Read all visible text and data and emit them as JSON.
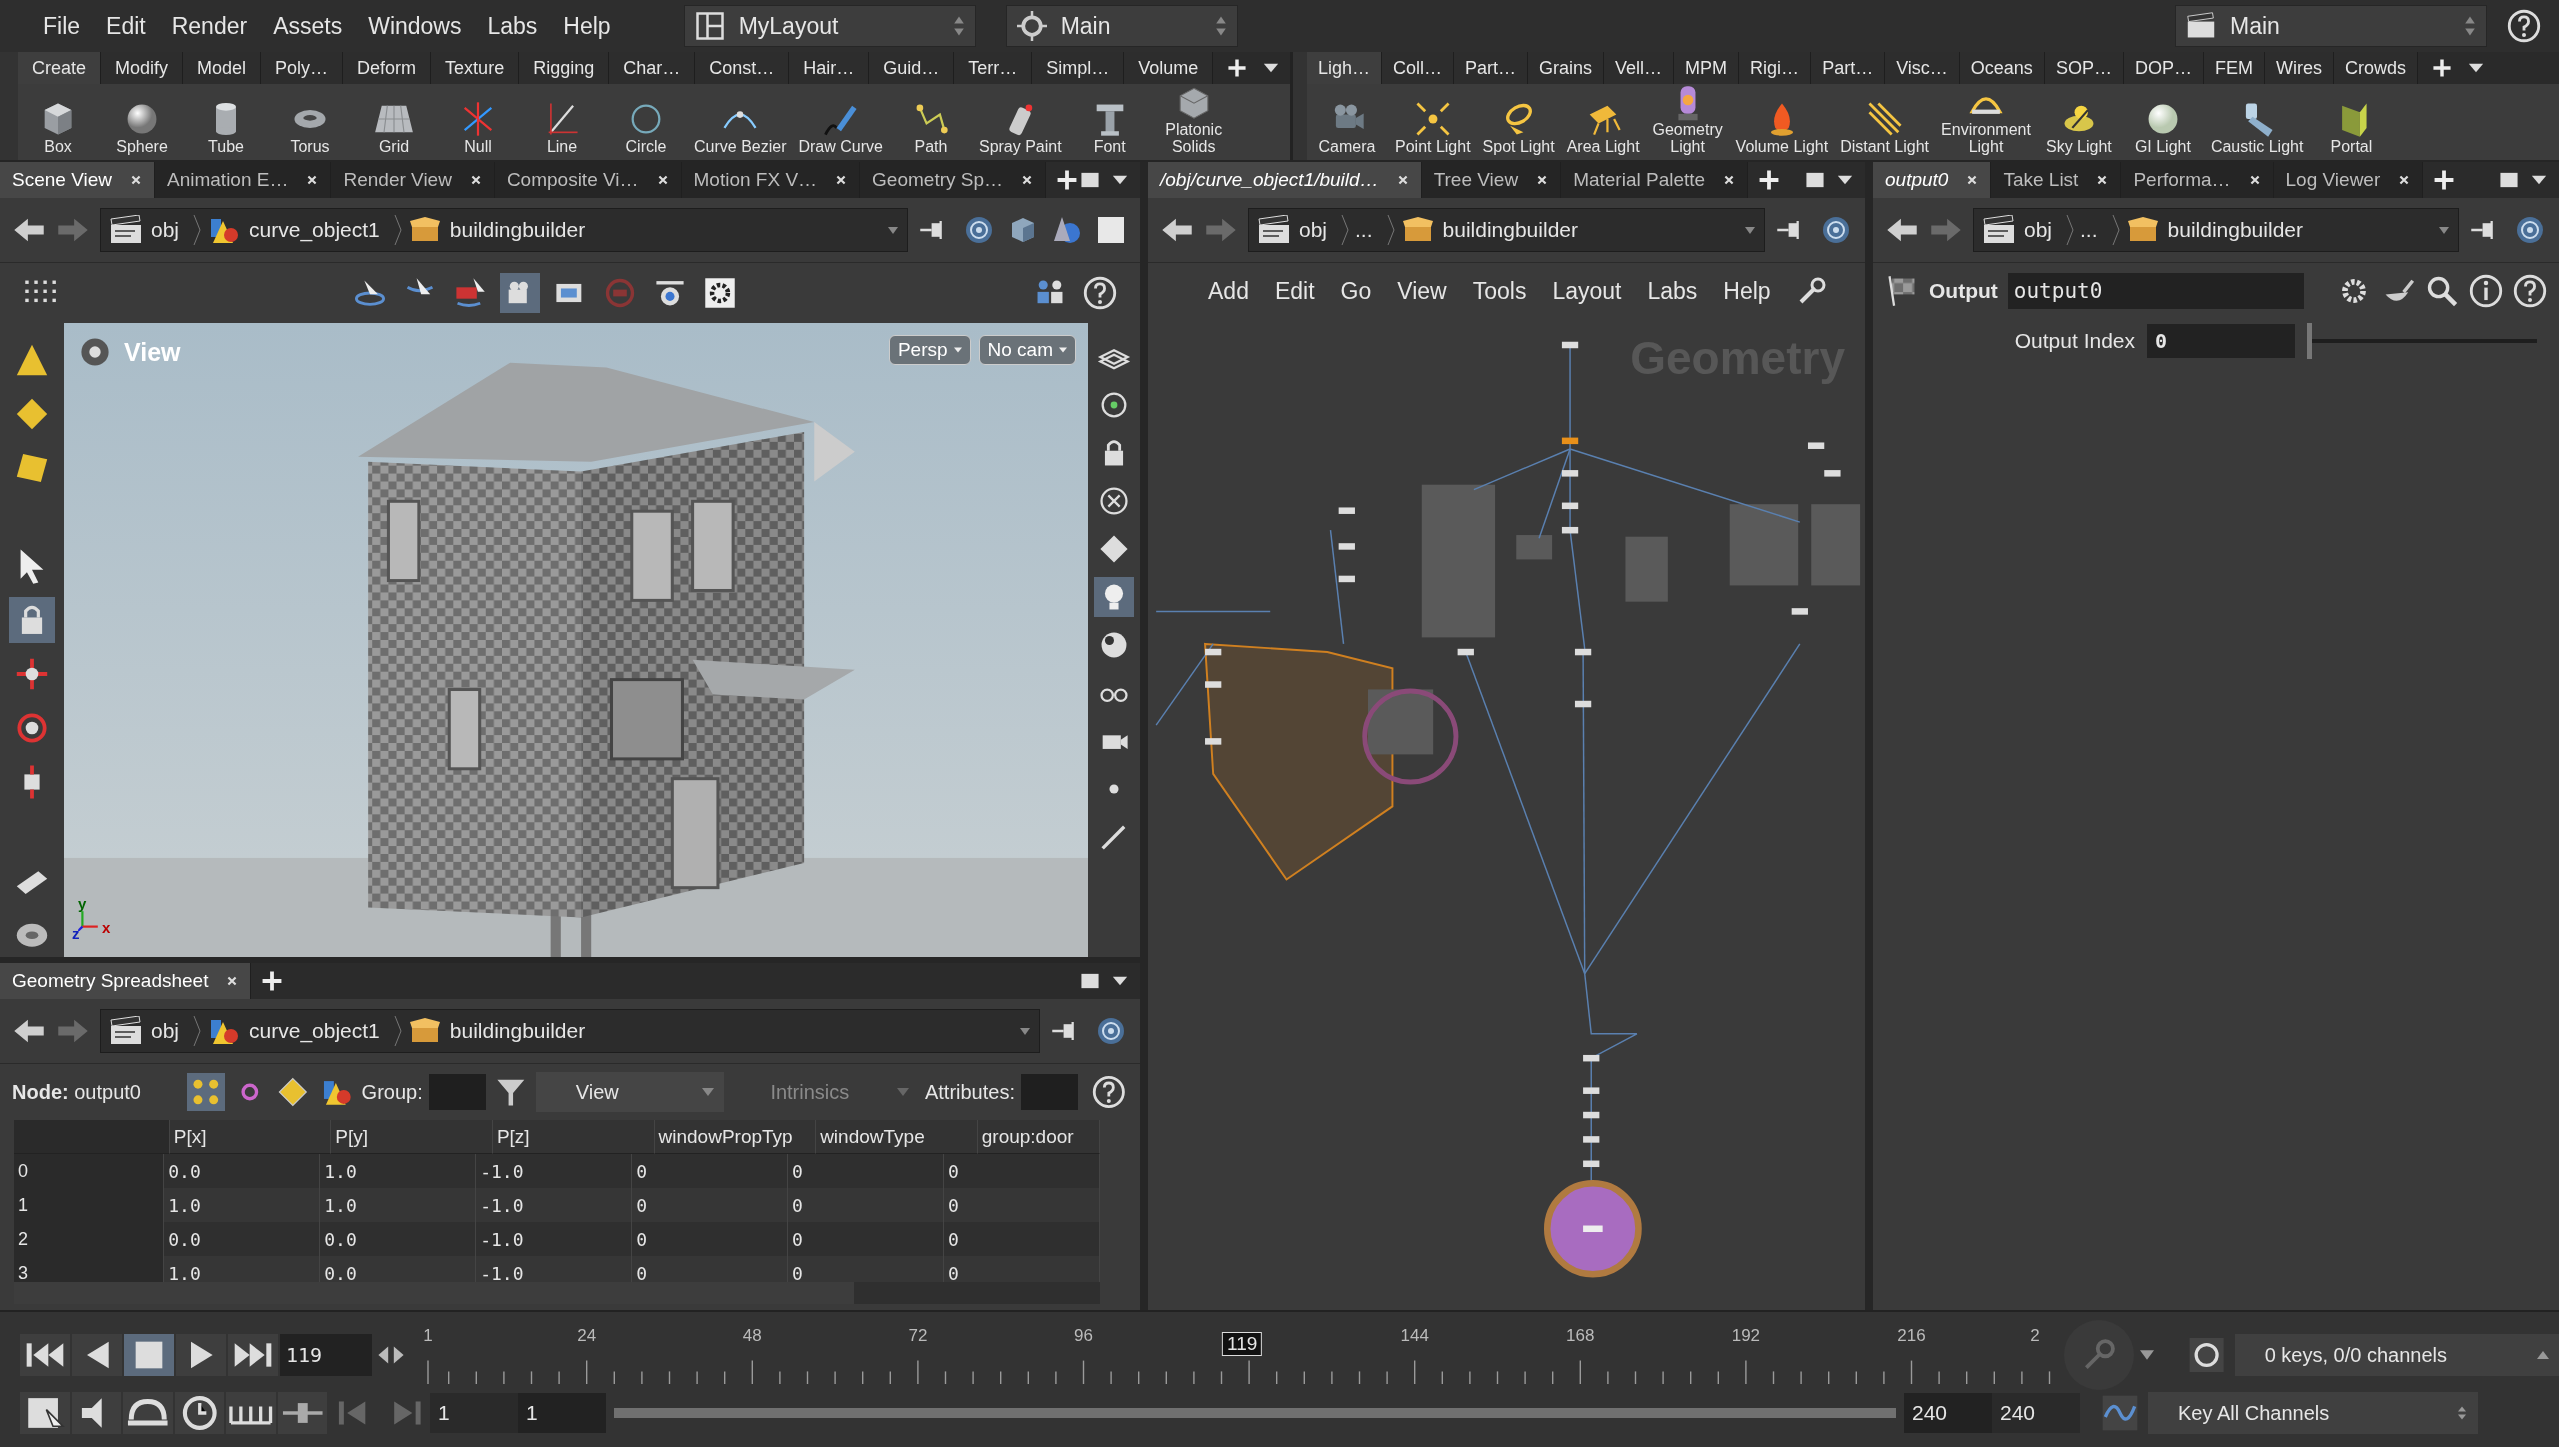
{
  "menu": [
    "File",
    "Edit",
    "Render",
    "Assets",
    "Windows",
    "Labs",
    "Help"
  ],
  "desktop": {
    "layout": "MyLayout",
    "context": "Main"
  },
  "take": "Main",
  "shelf_left": {
    "tabs": [
      {
        "label": "Create",
        "selected": true
      },
      {
        "label": "Modify",
        "selected": false
      },
      {
        "label": "Model",
        "selected": false
      },
      {
        "label": "Poly…",
        "selected": false
      },
      {
        "label": "Deform",
        "selected": false
      },
      {
        "label": "Texture",
        "selected": false
      },
      {
        "label": "Rigging",
        "selected": false
      },
      {
        "label": "Char…",
        "selected": false
      },
      {
        "label": "Const…",
        "selected": false
      },
      {
        "label": "Hair…",
        "selected": false
      },
      {
        "label": "Guid…",
        "selected": false
      },
      {
        "label": "Terr…",
        "selected": false
      },
      {
        "label": "Simpl…",
        "selected": false
      },
      {
        "label": "Volume",
        "selected": false
      }
    ],
    "tools": [
      "Box",
      "Sphere",
      "Tube",
      "Torus",
      "Grid",
      "Null",
      "Line",
      "Circle",
      "Curve Bezier",
      "Draw Curve",
      "Path",
      "Spray Paint",
      "Font",
      "Platonic\nSolids"
    ]
  },
  "shelf_right": {
    "tabs": [
      {
        "label": "Ligh…",
        "selected": true
      },
      {
        "label": "Coll…",
        "selected": false
      },
      {
        "label": "Part…",
        "selected": false
      },
      {
        "label": "Grains",
        "selected": false
      },
      {
        "label": "Vell…",
        "selected": false
      },
      {
        "label": "MPM",
        "selected": false
      },
      {
        "label": "Rigi…",
        "selected": false
      },
      {
        "label": "Part…",
        "selected": false
      },
      {
        "label": "Visc…",
        "selected": false
      },
      {
        "label": "Oceans",
        "selected": false
      },
      {
        "label": "SOP…",
        "selected": false
      },
      {
        "label": "DOP…",
        "selected": false
      },
      {
        "label": "FEM",
        "selected": false
      },
      {
        "label": "Wires",
        "selected": false
      },
      {
        "label": "Crowds",
        "selected": false
      }
    ],
    "tools": [
      "Camera",
      "Point Light",
      "Spot Light",
      "Area Light",
      "Geometry\nLight",
      "Volume Light",
      "Distant Light",
      "Environment\nLight",
      "Sky Light",
      "GI Light",
      "Caustic Light",
      "Portal"
    ]
  },
  "scene_pane": {
    "tabs": [
      {
        "label": "Scene View",
        "selected": true
      },
      {
        "label": "Animation E…",
        "selected": false
      },
      {
        "label": "Render View",
        "selected": false
      },
      {
        "label": "Composite Vi…",
        "selected": false
      },
      {
        "label": "Motion FX V…",
        "selected": false
      },
      {
        "label": "Geometry Sp…",
        "selected": false
      }
    ],
    "path": [
      {
        "kind": "scene",
        "label": "obj"
      },
      {
        "kind": "object",
        "label": "curve_object1"
      },
      {
        "kind": "subnet",
        "label": "buildingbuilder"
      }
    ],
    "viewport": {
      "title": "View",
      "camera": "Persp",
      "cam": "No cam",
      "axes": [
        "y",
        "z",
        "x"
      ]
    }
  },
  "spreadsheet": {
    "tabs": [
      {
        "label": "Geometry Spreadsheet",
        "selected": true
      }
    ],
    "path": [
      {
        "kind": "scene",
        "label": "obj"
      },
      {
        "kind": "object",
        "label": "curve_object1"
      },
      {
        "kind": "subnet",
        "label": "buildingbuilder"
      }
    ],
    "node": "**Node:** output0",
    "group_label": "Group:",
    "view": "View",
    "intrinsics": "Intrinsics",
    "attributes_label": "Attributes:",
    "columns": [
      "",
      "P[x]",
      "P[y]",
      "P[z]",
      "windowPropTyp",
      "windowType",
      "group:door"
    ],
    "rows": [
      [
        "0",
        "0.0",
        "1.0",
        "-1.0",
        "0",
        "0",
        "0"
      ],
      [
        "1",
        "1.0",
        "1.0",
        "-1.0",
        "0",
        "0",
        "0"
      ],
      [
        "2",
        "0.0",
        "0.0",
        "-1.0",
        "0",
        "0",
        "0"
      ],
      [
        "3",
        "1.0",
        "0.0",
        "-1.0",
        "0",
        "0",
        "0"
      ]
    ]
  },
  "network_pane": {
    "tabs": [
      {
        "label": "/obj/curve_object1/build…",
        "selected": true
      },
      {
        "label": "Tree View",
        "selected": false
      },
      {
        "label": "Material Palette",
        "selected": false
      }
    ],
    "path": [
      {
        "kind": "scene",
        "label": "obj"
      },
      {
        "kind": "more",
        "label": "..."
      },
      {
        "kind": "subnet",
        "label": "buildingbuilder"
      }
    ],
    "menu": [
      "Add",
      "Edit",
      "Go",
      "View",
      "Tools",
      "Layout",
      "Labs",
      "Help"
    ],
    "context": "Geometry"
  },
  "params_pane": {
    "tabs": [
      {
        "label": "output0",
        "selected": true
      },
      {
        "label": "Take List",
        "selected": false
      },
      {
        "label": "Performa…",
        "selected": false
      },
      {
        "label": "Log Viewer",
        "selected": false
      }
    ],
    "path": [
      {
        "kind": "scene",
        "label": "obj"
      },
      {
        "kind": "more",
        "label": "..."
      },
      {
        "kind": "subnet",
        "label": "buildingbuilder"
      }
    ],
    "node_type": "Output",
    "node_name": "output0",
    "output_index": {
      "label": "Output Index",
      "value": "0",
      "level": 0
    }
  },
  "timeline": {
    "frame": "119",
    "marker": "119",
    "ticks": [
      "1",
      "24",
      "48",
      "72",
      "96",
      "144",
      "168",
      "192",
      "216",
      "2"
    ],
    "start": "1",
    "range_start": "1",
    "range_end": "240",
    "end": "240",
    "keys": "0 keys, 0/0 channels",
    "key_all": "Key All Channels"
  }
}
